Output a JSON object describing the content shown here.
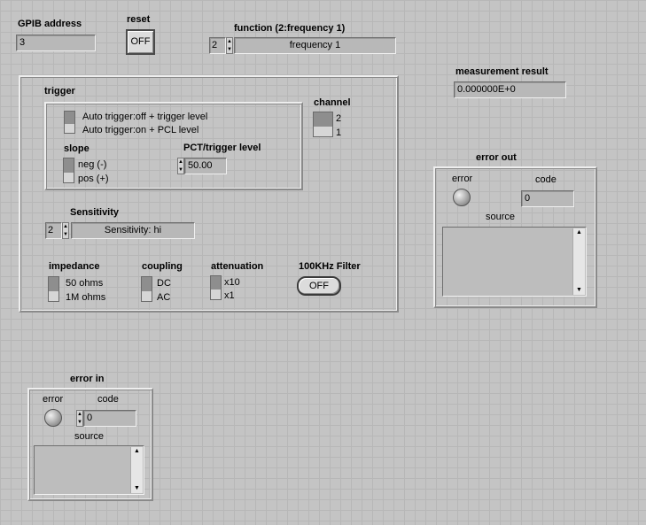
{
  "gpib": {
    "label": "GPIB address",
    "value": "3"
  },
  "reset": {
    "label": "reset",
    "button": "OFF"
  },
  "function": {
    "label": "function (2:frequency 1)",
    "index": "2",
    "value": "frequency 1"
  },
  "measurement": {
    "label": "measurement result",
    "value": "0.000000E+0"
  },
  "trigger": {
    "label": "trigger",
    "auto_on_text": "Auto trigger:off + trigger level",
    "auto_off_text": "Auto trigger:on  + PCL level",
    "slope_label": "slope",
    "slope_neg": "neg (-)",
    "slope_pos": "pos (+)",
    "pct_label": "PCT/trigger level",
    "pct_value": "50.00"
  },
  "channel": {
    "label": "channel",
    "opt_top": "2",
    "opt_bottom": "1"
  },
  "sensitivity": {
    "label": "Sensitivity",
    "index": "2",
    "value": "Sensitivity: hi"
  },
  "impedance": {
    "label": "impedance",
    "opt_top": "50 ohms",
    "opt_bottom": "1M ohms"
  },
  "coupling": {
    "label": "coupling",
    "opt_top": "DC",
    "opt_bottom": "AC"
  },
  "attenuation": {
    "label": "attenuation",
    "opt_top": "x10",
    "opt_bottom": "x1"
  },
  "filter": {
    "label": "100KHz Filter",
    "button": "OFF"
  },
  "error_out": {
    "title": "error out",
    "error_label": "error",
    "code_label": "code",
    "code_value": "0",
    "source_label": "source"
  },
  "error_in": {
    "title": "error in",
    "error_label": "error",
    "code_label": "code",
    "code_value": "0",
    "source_label": "source"
  },
  "icons": {
    "spin": "spin-arrows-icon",
    "scroll": "scroll-arrows-icon",
    "led": "status-led-icon"
  },
  "colors": {
    "panel_bg": "#c4c4c4",
    "grid": "#b7b7b7",
    "indicator_bg": "#b8b8b8",
    "button_bg": "#dcdcdc"
  }
}
